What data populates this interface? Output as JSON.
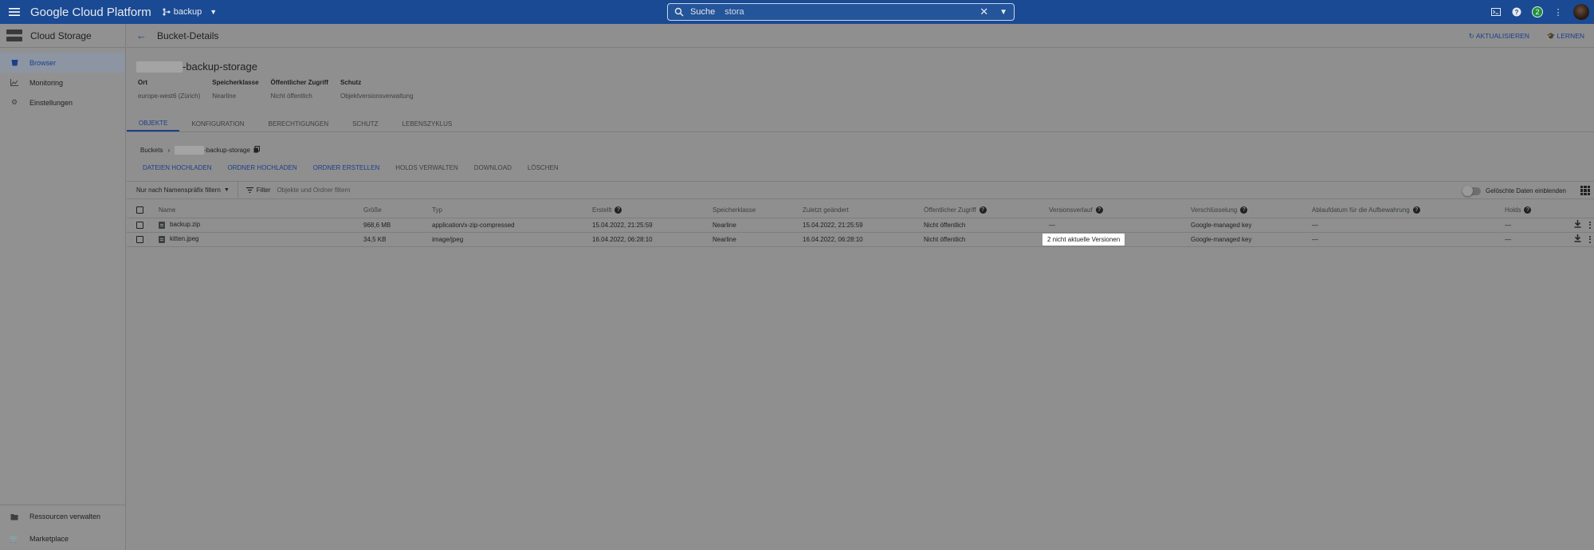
{
  "topbar": {
    "brand": "Google Cloud Platform",
    "project": "backup",
    "search_label": "Suche",
    "search_value": "stora",
    "notification_count": "2"
  },
  "sidebar": {
    "product": "Cloud Storage",
    "items": [
      {
        "label": "Browser",
        "icon": "bucket-icon",
        "active": true
      },
      {
        "label": "Monitoring",
        "icon": "chart-icon",
        "active": false
      },
      {
        "label": "Einstellungen",
        "icon": "gear-icon",
        "active": false
      }
    ],
    "bottom_items": [
      {
        "label": "Ressourcen verwalten",
        "icon": "folder-gear-icon"
      },
      {
        "label": "Marketplace",
        "icon": "cart-icon"
      }
    ]
  },
  "header": {
    "title": "Bucket-Details",
    "refresh": "AKTUALISIEREN",
    "learn": "LERNEN"
  },
  "bucket": {
    "name_suffix": "-backup-storage",
    "meta": [
      {
        "key": "Ort",
        "value": "europe-west6 (Zürich)"
      },
      {
        "key": "Speicherklasse",
        "value": "Nearline"
      },
      {
        "key": "Öffentlicher Zugriff",
        "value": "Nicht öffentlich"
      },
      {
        "key": "Schutz",
        "value": "Objektversionsverwaltung"
      }
    ]
  },
  "tabs": [
    "OBJEKTE",
    "KONFIGURATION",
    "BERECHTIGUNGEN",
    "SCHUTZ",
    "LEBENSZYKLUS"
  ],
  "breadcrumb": {
    "root": "Buckets",
    "bucket_suffix": "-backup-storage"
  },
  "actions": [
    {
      "label": "DATEIEN HOCHLADEN",
      "enabled": true
    },
    {
      "label": "ORDNER HOCHLADEN",
      "enabled": true
    },
    {
      "label": "ORDNER ERSTELLEN",
      "enabled": true
    },
    {
      "label": "HOLDS VERWALTEN",
      "enabled": false
    },
    {
      "label": "DOWNLOAD",
      "enabled": false
    },
    {
      "label": "LÖSCHEN",
      "enabled": false
    }
  ],
  "filterbar": {
    "prefix_filter": "Nur nach Namenspräfix filtern",
    "filter_label": "Filter",
    "filter_placeholder": "Objekte und Ordner filtern",
    "show_deleted": "Gelöschte Daten einblenden"
  },
  "table": {
    "columns": [
      "Name",
      "Größe",
      "Typ",
      "Erstellt",
      "Speicherklasse",
      "Zuletzt geändert",
      "Öffentlicher Zugriff",
      "Versionsverlauf",
      "Verschlüsselung",
      "Ablaufdatum für die Aufbewahrung",
      "Holds"
    ],
    "rows": [
      {
        "name": "backup.zip",
        "size": "968,6 MB",
        "type": "application/x-zip-compressed",
        "created": "15.04.2022, 21:25:59",
        "storage_class": "Nearline",
        "modified": "15.04.2022, 21:25:59",
        "public": "Nicht öffentlich",
        "versions": "—",
        "encryption": "Google-managed key",
        "retention": "—",
        "holds": "—"
      },
      {
        "name": "kitten.jpeg",
        "size": "34,5 KB",
        "type": "image/jpeg",
        "created": "16.04.2022, 06:28:10",
        "storage_class": "Nearline",
        "modified": "16.04.2022, 06:28:10",
        "public": "Nicht öffentlich",
        "versions": "2 nicht aktuelle Versionen",
        "encryption": "Google-managed key",
        "retention": "—",
        "holds": "—"
      }
    ]
  },
  "colors": {
    "topbar": "#1a4a94",
    "accent": "#1a3f8a",
    "overlay": "#8f8f8f"
  }
}
